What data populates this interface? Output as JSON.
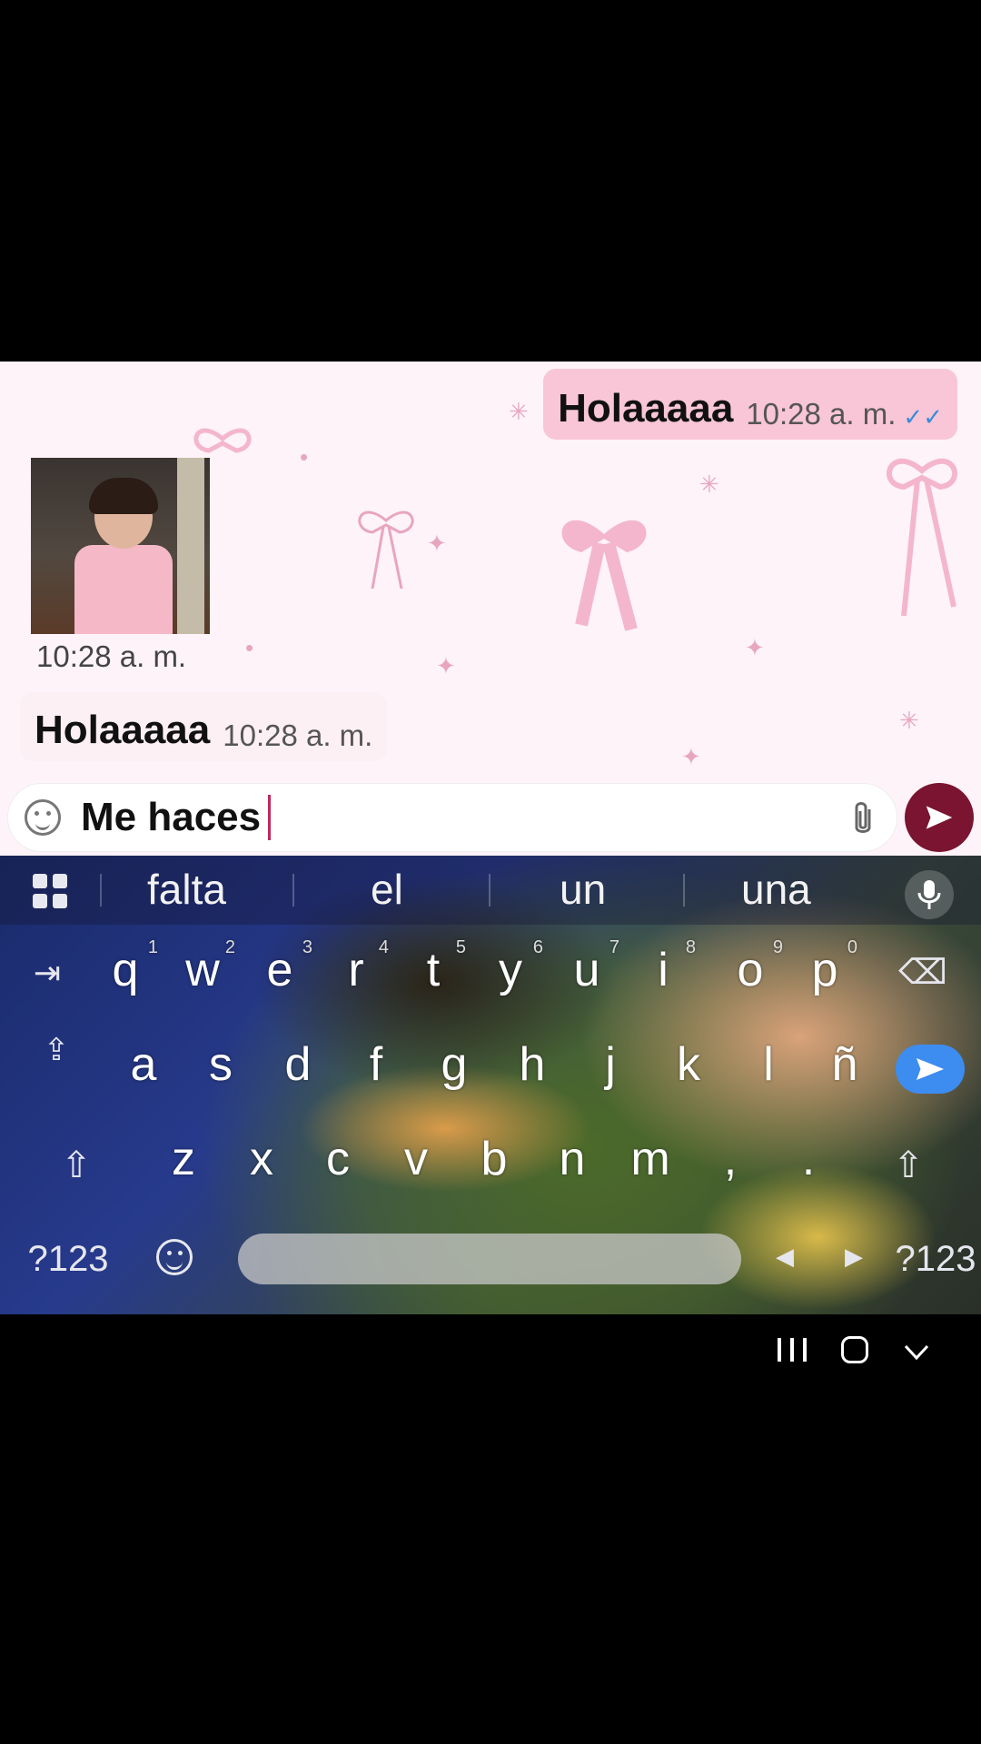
{
  "chat": {
    "outgoing": {
      "text": "Holaaaaa",
      "time": "10:28 a. m."
    },
    "media": {
      "time": "10:28 a. m."
    },
    "incoming": {
      "text": "Holaaaaa",
      "time": "10:28 a. m."
    }
  },
  "composer": {
    "value": "Me haces",
    "icons": {
      "sticker": "sticker-icon",
      "attach": "paperclip-icon",
      "send": "send-icon"
    },
    "send_color": "#7a1430"
  },
  "keyboard": {
    "suggestions": [
      "falta",
      "el",
      "un",
      "una"
    ],
    "row1": [
      {
        "k": "q",
        "n": "1"
      },
      {
        "k": "w",
        "n": "2"
      },
      {
        "k": "e",
        "n": "3"
      },
      {
        "k": "r",
        "n": "4"
      },
      {
        "k": "t",
        "n": "5"
      },
      {
        "k": "y",
        "n": "6"
      },
      {
        "k": "u",
        "n": "7"
      },
      {
        "k": "i",
        "n": "8"
      },
      {
        "k": "o",
        "n": "9"
      },
      {
        "k": "p",
        "n": "0"
      }
    ],
    "row2": [
      "a",
      "s",
      "d",
      "f",
      "g",
      "h",
      "j",
      "k",
      "l",
      "ñ"
    ],
    "row3": [
      "z",
      "x",
      "c",
      "v",
      "b",
      "n",
      "m",
      ",",
      "."
    ],
    "symbols_label": "?123",
    "symbols_label_right": "?123",
    "enter_color": "#3d8df0"
  }
}
